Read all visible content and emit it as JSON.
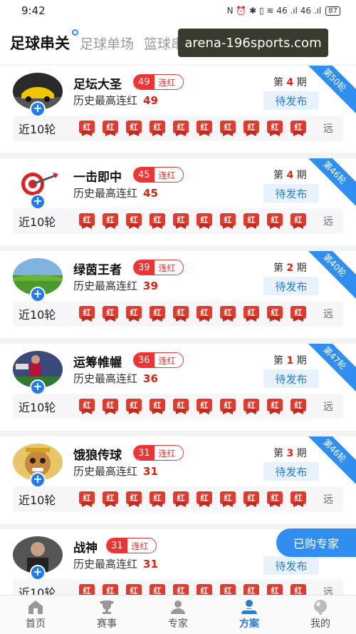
{
  "status": {
    "time": "9:42",
    "icons": "N ⏰ ✱ ▯ ≋ 46 .ıl 46 .ıl",
    "battery": "87"
  },
  "tabs": [
    {
      "label": "足球串关",
      "active": true
    },
    {
      "label": "足球单场",
      "active": false
    },
    {
      "label": "篮球串关单关",
      "active": false
    }
  ],
  "watermark": "arena-196sports.com",
  "card_labels": {
    "recent": "近10轮",
    "far": "远",
    "hist_prefix": "历史最高连红",
    "period_prefix": "第",
    "period_suffix": "期",
    "publish": "待发布",
    "streak_suffix": "连红",
    "result": "红"
  },
  "experts": [
    {
      "name": "足坛大圣",
      "streak": "49",
      "hist": "49",
      "period": "4",
      "round": "第50轮",
      "avatar": "car"
    },
    {
      "name": "一击即中",
      "streak": "45",
      "hist": "45",
      "period": "4",
      "round": "第46轮",
      "avatar": "target"
    },
    {
      "name": "绿茵王者",
      "streak": "39",
      "hist": "39",
      "period": "2",
      "round": "第40轮",
      "avatar": "field"
    },
    {
      "name": "运筹帷幄",
      "streak": "36",
      "hist": "36",
      "period": "1",
      "round": "第47轮",
      "avatar": "player"
    },
    {
      "name": "饿狼传球",
      "streak": "31",
      "hist": "31",
      "period": "3",
      "round": "第46轮",
      "avatar": "monkey"
    },
    {
      "name": "战神",
      "streak": "31",
      "hist": "31",
      "period": "",
      "round": "",
      "avatar": "man"
    }
  ],
  "floating_button": "已购专家",
  "nav": [
    {
      "label": "首页",
      "icon": "home-icon",
      "active": false
    },
    {
      "label": "赛事",
      "icon": "trophy-icon",
      "active": false
    },
    {
      "label": "专家",
      "icon": "expert-icon",
      "active": false
    },
    {
      "label": "方案",
      "icon": "plan-icon",
      "active": true
    },
    {
      "label": "我的",
      "icon": "profile-icon",
      "active": false
    }
  ],
  "colors": {
    "accent": "#2f8ef0",
    "red": "#e23b2e"
  }
}
